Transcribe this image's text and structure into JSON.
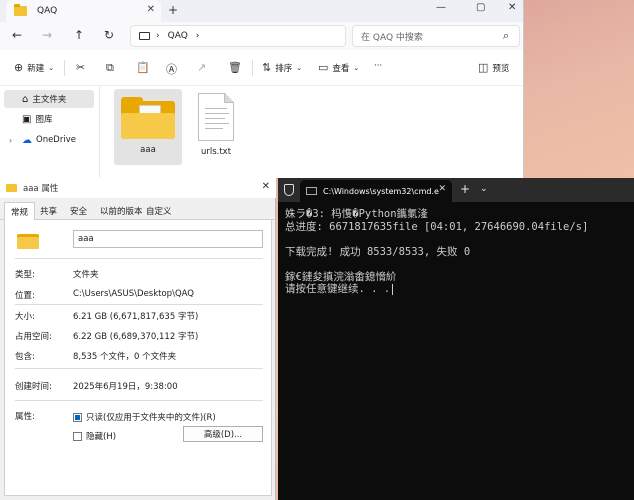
{
  "explorer": {
    "tab_title": "QAQ",
    "tab_close": "✕",
    "new_tab": "+",
    "window_controls": [
      "—",
      "▢",
      "✕"
    ],
    "breadcrumb": [
      "QAQ",
      "›"
    ],
    "search_placeholder": "在 QAQ 中搜索",
    "commands": {
      "new": "新建",
      "sort": "排序",
      "view": "查看",
      "more": "···",
      "preview": "预览"
    },
    "sidebar": {
      "home": "主文件夹",
      "gallery": "图库",
      "onedrive": "OneDrive"
    },
    "files": [
      {
        "name": "aaa",
        "type": "folder"
      },
      {
        "name": "urls.txt",
        "type": "text"
      }
    ]
  },
  "properties": {
    "title": "aaa 属性",
    "close": "✕",
    "tabs": [
      "常规",
      "共享",
      "安全",
      "以前的版本",
      "自定义"
    ],
    "name_value": "aaa",
    "rows": {
      "type_label": "类型:",
      "type_value": "文件夹",
      "location_label": "位置:",
      "location_value": "C:\\Users\\ASUS\\Desktop\\QAQ",
      "size_label": "大小:",
      "size_value": "6.21 GB (6,671,817,635 字节)",
      "disk_label": "占用空间:",
      "disk_value": "6.22 GB (6,689,370,112 字节)",
      "contains_label": "包含:",
      "contains_value": "8,535 个文件，0 个文件夹",
      "created_label": "创建时间:",
      "created_value": "2025年6月19日，9:38:00",
      "attr_label": "属性:"
    },
    "readonly_label": "只读(仅应用于文件夹中的文件)(R)",
    "hidden_label": "隐藏(H)",
    "advanced_label": "高级(D)..."
  },
  "terminal": {
    "tab_title": "C:\\Windows\\system32\\cmd.e",
    "tab_close": "✕",
    "plus": "+",
    "chevron": "⌄",
    "lines": [
      "姝ラ�3: 杩愯�Python鑴氭湰",
      "总进度: 6671817635file [04:01, 27646690.04file/s]",
      "",
      "下载完成! 成功 8533/8533, 失败 0",
      "",
      "鎵€鏈夋搷浣滃畬鎴愶紒",
      "请按任意键继续. . ."
    ]
  }
}
